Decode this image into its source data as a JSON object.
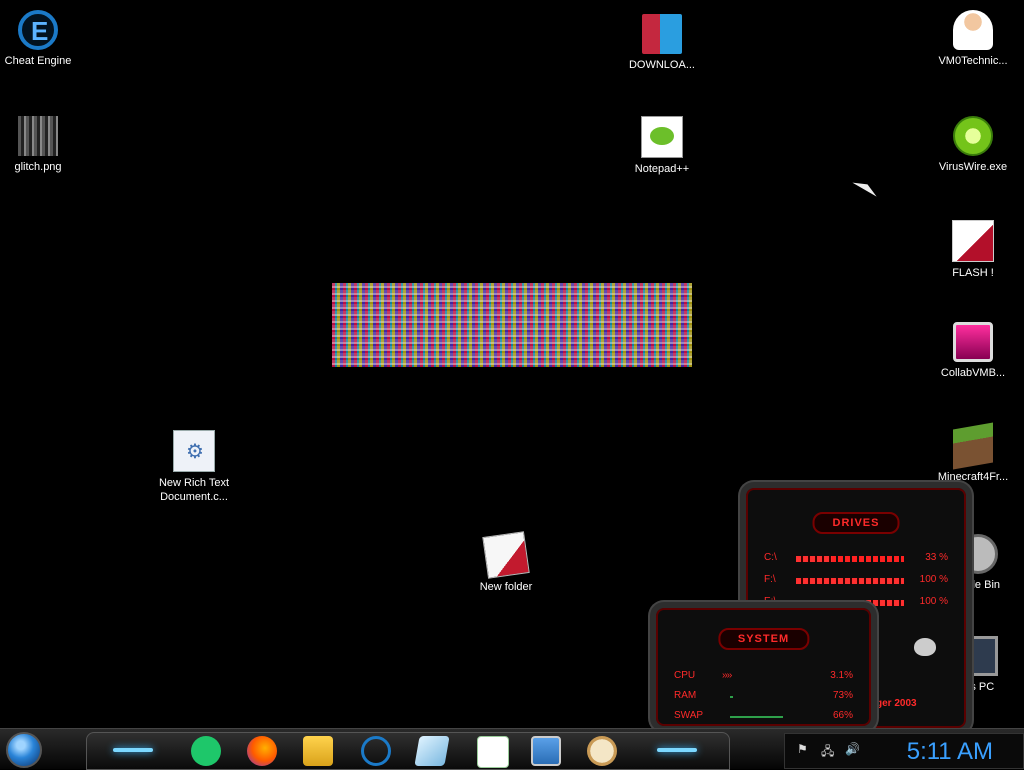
{
  "desktop": {
    "icons": {
      "cheat_engine": "Cheat Engine",
      "download": "DOWNLOA...",
      "vm0": "VM0Technic...",
      "glitch": "glitch.png",
      "notepadpp": "Notepad++",
      "viruswire": "VirusWire.exe",
      "flash": "FLASH !",
      "collab": "CollabVMB...",
      "minecraft": "Minecraft4Fr...",
      "new_rtf_line1": "New Rich Text",
      "new_rtf_line2": "Document.c...",
      "new_folder": "New folder",
      "recycle": "cycle Bin",
      "this_pc": "his PC"
    }
  },
  "drives_gadget": {
    "title": "DRIVES",
    "rows": [
      {
        "name": "C:\\",
        "percent": 33,
        "pct_label": "33 %"
      },
      {
        "name": "F:\\",
        "percent": 100,
        "pct_label": "100 %"
      },
      {
        "name": "E:\\",
        "percent": 100,
        "pct_label": "100 %"
      }
    ],
    "footer": "ger 2003"
  },
  "system_gadget": {
    "title": "SYSTEM",
    "rows": [
      {
        "name": "CPU",
        "value": "3.1%"
      },
      {
        "name": "RAM",
        "value": "73%"
      },
      {
        "name": "SWAP",
        "value": "66%"
      }
    ]
  },
  "taskbar": {
    "clock": "5:11 AM",
    "colors": {
      "clock": "#3aa0ff",
      "accent_red": "#ff2a2a"
    }
  }
}
